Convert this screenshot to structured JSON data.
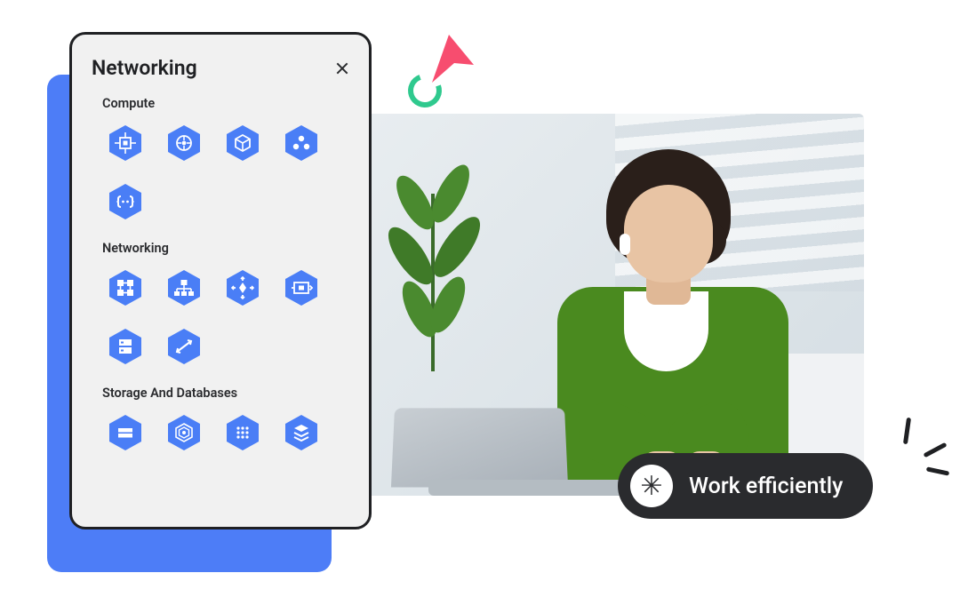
{
  "panel": {
    "title": "Networking",
    "sections": [
      {
        "title": "Compute",
        "icons": [
          "compute-engine-icon",
          "kubernetes-icon",
          "container-icon",
          "cluster-icon",
          "functions-icon"
        ]
      },
      {
        "title": "Networking",
        "icons": [
          "load-balancer-icon",
          "network-topology-icon",
          "cdn-icon",
          "vpc-icon",
          "dns-icon",
          "interconnect-icon"
        ]
      },
      {
        "title": "Storage And Databases",
        "icons": [
          "storage-icon",
          "bigquery-icon",
          "dataflow-icon",
          "layers-icon"
        ]
      }
    ]
  },
  "badge": {
    "label": "Work efficiently"
  },
  "colors": {
    "hex": "#4a7ef6",
    "accent": "#4d7df7",
    "pill": "#2a2b2e",
    "green": "#2fc98e",
    "pink": "#f74d6f"
  }
}
